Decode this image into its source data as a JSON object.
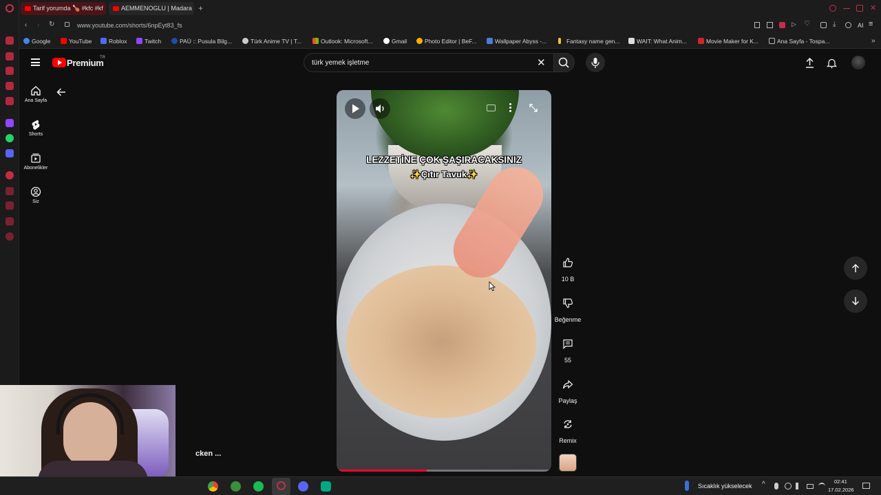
{
  "browser": {
    "tabs": [
      {
        "title": "Tarif yorumda 🍗 #kfc #kf",
        "active": true
      },
      {
        "title": "AEMMENOGLU | Madara",
        "active": false
      }
    ],
    "new_tab_symbol": "+",
    "url": "www.youtube.com/shorts/6npEyt83_fs",
    "ai_label": "AI",
    "bookmarks": [
      {
        "label": "Google",
        "color": "#4285f4"
      },
      {
        "label": "YouTube",
        "color": "#ff0000"
      },
      {
        "label": "Roblox",
        "color": "#4a6cf7"
      },
      {
        "label": "Twitch",
        "color": "#9146ff"
      },
      {
        "label": "PAÜ :: Pusula Bilg...",
        "color": "#1e4fa3"
      },
      {
        "label": "Türk Anime TV | T...",
        "color": "#cccccc"
      },
      {
        "label": "Outlook: Microsoft...",
        "color": "#f25022"
      },
      {
        "label": "Gmail",
        "color": "#ffffff"
      },
      {
        "label": "Photo Editor | BeF...",
        "color": "#ffb000"
      },
      {
        "label": "Wallpaper Abyss -...",
        "color": "#4e7bd8"
      },
      {
        "label": "Fantasy name gen...",
        "color": "#f0c040"
      },
      {
        "label": "WAIT: What Anim...",
        "color": "#dddddd"
      },
      {
        "label": "Movie Maker for K...",
        "color": "#d2242c"
      },
      {
        "label": "Ana Sayfa - Tospa...",
        "color": "#bbbbbb"
      }
    ]
  },
  "youtube": {
    "logo_text": "Premium",
    "logo_badge": "TR",
    "search_value": "türk yemek işletme",
    "sidebar": [
      {
        "label": "Ana Sayfa",
        "icon": "home-icon"
      },
      {
        "label": "Shorts",
        "icon": "shorts-icon"
      },
      {
        "label": "Abonelikler",
        "icon": "subscriptions-icon"
      },
      {
        "label": "Siz",
        "icon": "account-icon"
      }
    ],
    "video": {
      "overlay_title": "LEZZETİNE ÇOK ŞAŞIRACAKSINIZ",
      "overlay_subtitle": "✨Çıtır Tavuk✨",
      "progress": 0.42
    },
    "actions": {
      "like_count": "10 B",
      "dislike_label": "Beğenme",
      "comment_count": "55",
      "share_label": "Paylaş",
      "remix_label": "Remix"
    },
    "partial_caption": "cken ..."
  },
  "taskbar": {
    "weather_text": "Sıcaklık yükselecek",
    "time": "02:41",
    "date": "17.02.2026"
  },
  "colors": {
    "yt_red": "#ff0000",
    "progress_red": "#ff0033",
    "opera_red": "#c0304a"
  }
}
